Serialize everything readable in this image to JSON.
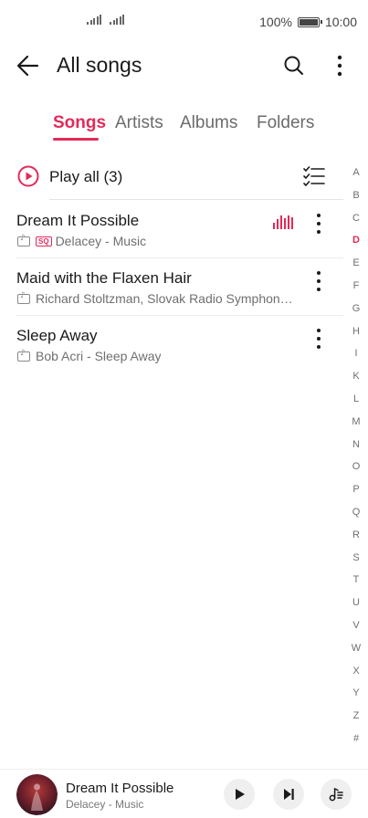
{
  "status": {
    "battery": "100%",
    "time": "10:00"
  },
  "header": {
    "title": "All songs"
  },
  "tabs": [
    "Songs",
    "Artists",
    "Albums",
    "Folders"
  ],
  "play_all": {
    "label": "Play all (3)"
  },
  "songs": [
    {
      "title": "Dream It Possible",
      "meta": "Delacey - Music",
      "badge": "SQ"
    },
    {
      "title": "Maid with the Flaxen Hair",
      "meta": "Richard Stoltzman, Slovak Radio Symphon…"
    },
    {
      "title": "Sleep Away",
      "meta": "Bob Acri - Sleep Away"
    }
  ],
  "index": [
    "A",
    "B",
    "C",
    "D",
    "E",
    "F",
    "G",
    "H",
    "I",
    "K",
    "L",
    "M",
    "N",
    "O",
    "P",
    "Q",
    "R",
    "S",
    "T",
    "U",
    "V",
    "W",
    "X",
    "Y",
    "Z",
    "#"
  ],
  "index_highlight": "D",
  "player": {
    "title": "Dream It Possible",
    "subtitle": "Delacey - Music"
  },
  "colors": {
    "accent": "#e22a5a"
  }
}
